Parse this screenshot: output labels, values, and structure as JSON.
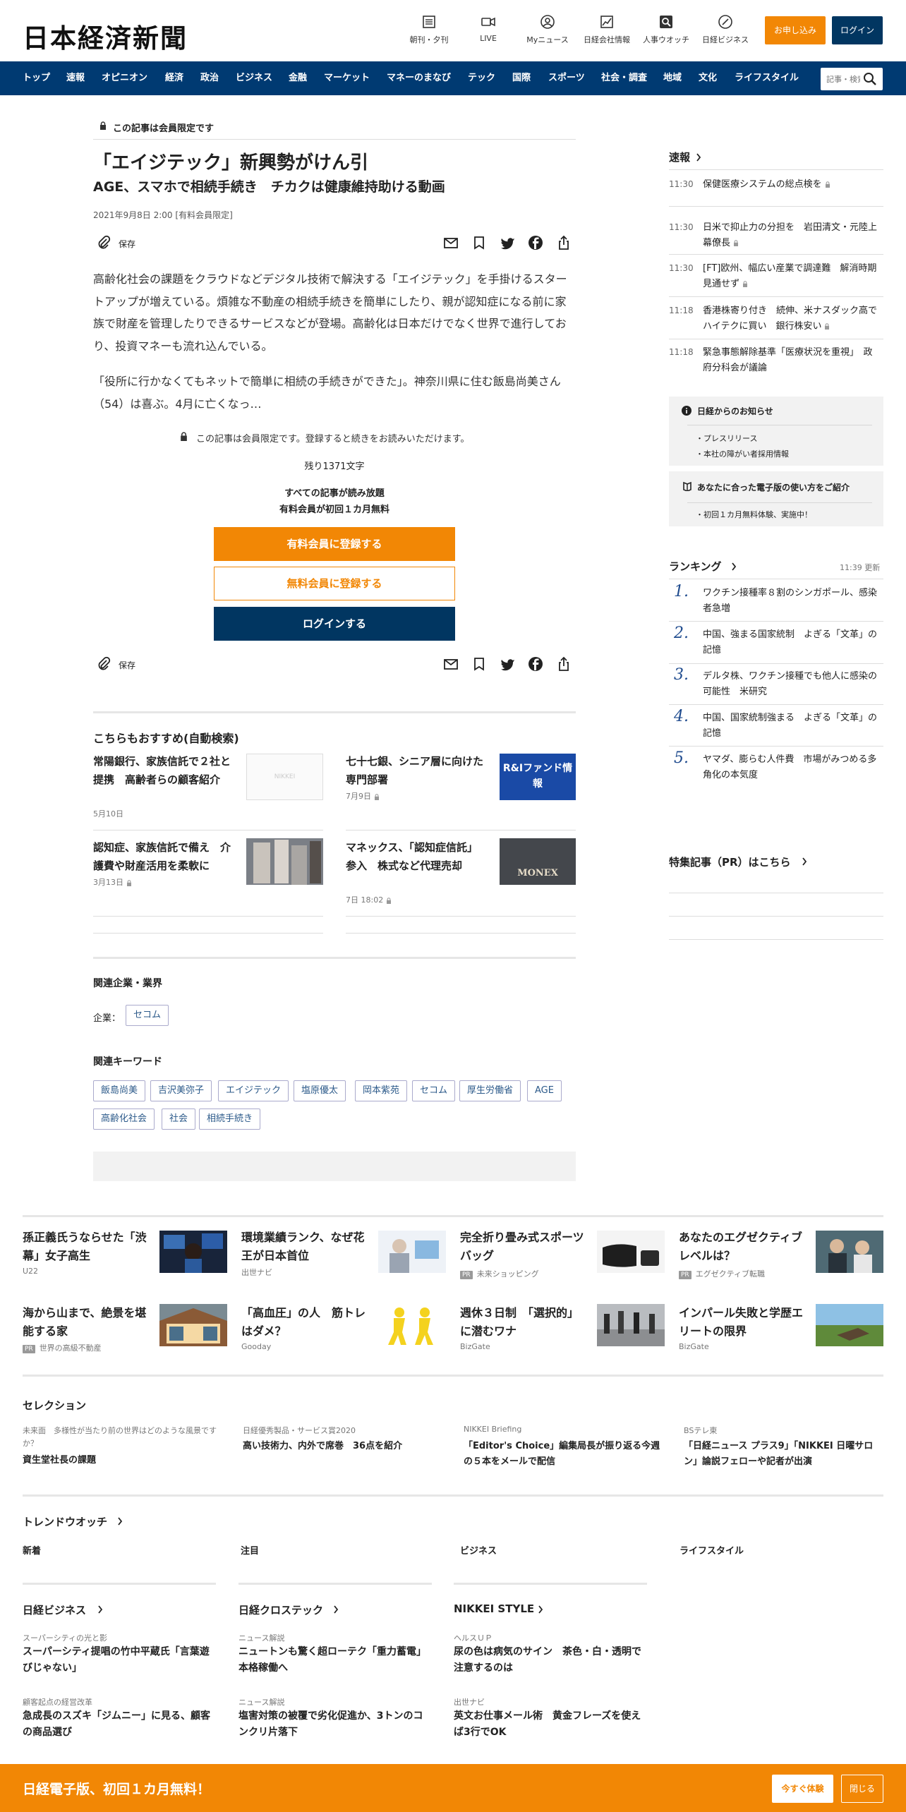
{
  "header": {
    "logo": "日本経済新聞",
    "icons": [
      {
        "label": "朝刊・夕刊",
        "icon": "newspaper-icon"
      },
      {
        "label": "LIVE",
        "icon": "video-icon"
      },
      {
        "label": "Myニュース",
        "icon": "user-icon"
      },
      {
        "label": "日経会社情報",
        "icon": "chart-icon"
      },
      {
        "label": "人事ウオッチ",
        "icon": "search-person-icon"
      },
      {
        "label": "日経ビジネス",
        "icon": "nb-icon"
      }
    ],
    "subscribe": "お申し込み",
    "login": "ログイン"
  },
  "nav": {
    "items": [
      "トップ",
      "速報",
      "オピニオン",
      "経済",
      "政治",
      "ビジネス",
      "金融",
      "マーケット",
      "マネーのまなび",
      "テック",
      "国際",
      "スポーツ",
      "社会・調査",
      "地域",
      "文化",
      "ライフスタイル"
    ],
    "search_placeholder": "記事・検索"
  },
  "article": {
    "member_label": "この記事は会員限定です",
    "title": "「エイジテック」新興勢がけん引",
    "subtitle": "AGE、スマホで相続手続き　チカクは健康維持助ける動画",
    "date": "2021年9月8日 2:00 [有料会員限定]",
    "save": "保存",
    "p1": "高齢化社会の課題をクラウドなどデジタル技術で解決する「エイジテック」を手掛けるスタートアップが増えている。煩雑な不動産の相続手続きを簡単にしたり、親が認知症になる前に家族で財産を管理したりできるサービスなどが登場。高齢化は日本だけでなく世界で進行しており、投資マネーも流れ込んでいる。",
    "p2": "「役所に行かなくてもネットで簡単に相続の手続きができた」。神奈川県に住む飯島尚美さん（54）は喜ぶ。4月に亡くなっ…",
    "paywall_notice": "この記事は会員限定です。登録すると続きをお読みいただけます。",
    "remaining": "残り1371文字",
    "offer1": "すべての記事が読み放題",
    "offer2": "有料会員が初回１カ月無料",
    "btn_paid": "有料会員に登録する",
    "btn_free": "無料会員に登録する",
    "btn_login": "ログインする"
  },
  "recommend": {
    "title": "こちらもおすすめ(自動検索)",
    "items": [
      {
        "title": "常陽銀行、家族信託で２社と提携　高齢者らの顧客紹介",
        "date": "5月10日",
        "thumb": "NIKKEI"
      },
      {
        "title": "七十七銀、シニア層に向けた専門部署",
        "date": "7月9日",
        "thumb": "R&Iファンド情報"
      },
      {
        "title": "認知症、家族信託で備え　介護費や財産活用を柔軟に",
        "date": "3月13日",
        "thumb": ""
      },
      {
        "title": "マネックス、「認知症信託」参入　株式など代理売却",
        "date": "7日 18:02",
        "thumb": "MONEX"
      }
    ]
  },
  "related": {
    "companies_title": "関連企業・業界",
    "companies_label": "企業：",
    "companies": [
      "セコム"
    ],
    "keywords_title": "関連キーワード",
    "keywords": [
      "飯島尚美",
      "吉沢美弥子",
      "エイジテック",
      "塩原優太",
      "岡本紫苑",
      "セコム",
      "厚生労働省",
      "AGE",
      "高齢化社会",
      "社会",
      "相続手続き"
    ]
  },
  "sidebar": {
    "sokuho_title": "速報",
    "sokuho": [
      {
        "time": "11:30",
        "text": "保健医療システムの総点検を"
      },
      {
        "time": "11:30",
        "text": "日米で抑止力の分担を　岩田清文・元陸上幕僚長"
      },
      {
        "time": "11:30",
        "text": "[FT]欧州、幅広い産業で調達難　解消時期見通せず"
      },
      {
        "time": "11:18",
        "text": "香港株寄り付き　続伸、米ナスダック高でハイテクに買い　銀行株安い"
      },
      {
        "time": "11:18",
        "text": "緊急事態解除基準「医療状況を重視」　政府分科会が議論"
      }
    ],
    "notice_title": "日経からのお知らせ",
    "notices": [
      "プレスリリース",
      "本社の障がい者採用情報"
    ],
    "guide_title": "あなたに合った電子版の使い方をご紹介",
    "guides": [
      "初回１カ月無料体験、実施中！"
    ],
    "ranking_title": "ランキング",
    "ranking_time": "11:39  更新",
    "ranking": [
      "ワクチン接種率８割のシンガポール、感染者急増",
      "中国、強まる国家統制　よぎる「文革」の記憶",
      "デルタ株、ワクチン接種でも他人に感染の可能性　米研究",
      "中国、国家統制強まる　よぎる「文革」の記憶",
      "ヤマダ、膨らむ人件費　市場がみつめる多角化の本気度"
    ],
    "pr_title": "特集記事（PR）はこちら"
  },
  "ads": [
    {
      "title": "孫正義氏うならせた「渋幕」女子高生",
      "source": "U22",
      "pr": false
    },
    {
      "title": "環境業績ランク、なぜ花王が日本首位",
      "source": "出世ナビ",
      "pr": false
    },
    {
      "title": "完全折り畳み式スポーツバッグ",
      "source": "未来ショッピング",
      "pr": true
    },
    {
      "title": "あなたのエグゼクティブレベルは？",
      "source": "エグゼクティブ転職",
      "pr": true
    },
    {
      "title": "海から山まで、絶景を堪能する家",
      "source": "世界の高級不動産",
      "pr": true
    },
    {
      "title": "「高血圧」の人　筋トレはダメ？",
      "source": "Gooday",
      "pr": false
    },
    {
      "title": "週休３日制　「選択的」に潜むワナ",
      "source": "BizGate",
      "pr": false
    },
    {
      "title": "インパール失敗と学歴エリートの限界",
      "source": "BizGate",
      "pr": false
    }
  ],
  "selection": {
    "title": "セレクション",
    "items": [
      {
        "label": "未来面　多様性が当たり前の世界はどのような風景ですか？",
        "title": "資生堂社長の課題"
      },
      {
        "label": "日経優秀製品・サービス賞2020",
        "title": "高い技術力、内外で席巻　36点を紹介"
      },
      {
        "label": "NIKKEI Briefing",
        "title": "「Editor's Choice」編集局長が振り返る今週の５本をメールで配信"
      },
      {
        "label": "BSテレ東",
        "title": "「日経ニュース プラス9」「NIKKEI 日曜サロン」論説フェローや記者が出演"
      }
    ]
  },
  "trend": {
    "title": "トレンドウオッチ",
    "cols": [
      "新着",
      "注目",
      "ビジネス",
      "ライフスタイル"
    ]
  },
  "media": [
    {
      "title": "日経ビジネス",
      "items": [
        {
          "label": "スーパーシティの光と影",
          "title": "スーパーシティ提唱の竹中平蔵氏「言葉遊びじゃない」"
        },
        {
          "label": "顧客起点の経営改革",
          "title": "急成長のスズキ「ジムニー」に見る、顧客の商品選び"
        }
      ]
    },
    {
      "title": "日経クロステック",
      "items": [
        {
          "label": "ニュース解説",
          "title": "ニュートンも驚く超ローテク「重力蓄電」　本格稼働へ"
        },
        {
          "label": "ニュース解説",
          "title": "塩害対策の被覆で劣化促進か、3トンのコンクリ片落下"
        }
      ]
    },
    {
      "title": "NIKKEI STYLE",
      "items": [
        {
          "label": "ヘルスＵＰ",
          "title": "尿の色は病気のサイン　茶色・白・透明で注意するのは"
        },
        {
          "label": "出世ナビ",
          "title": "英文お仕事メール術　黄金フレーズを使えば3行でOK"
        }
      ]
    }
  ],
  "footer": {
    "promo": "日経電子版、初回１カ月無料！",
    "try": "今すぐ体験",
    "close": "閉じる"
  },
  "colors": {
    "nav": "#003a72",
    "accent": "#f28705",
    "navy": "#013661"
  }
}
